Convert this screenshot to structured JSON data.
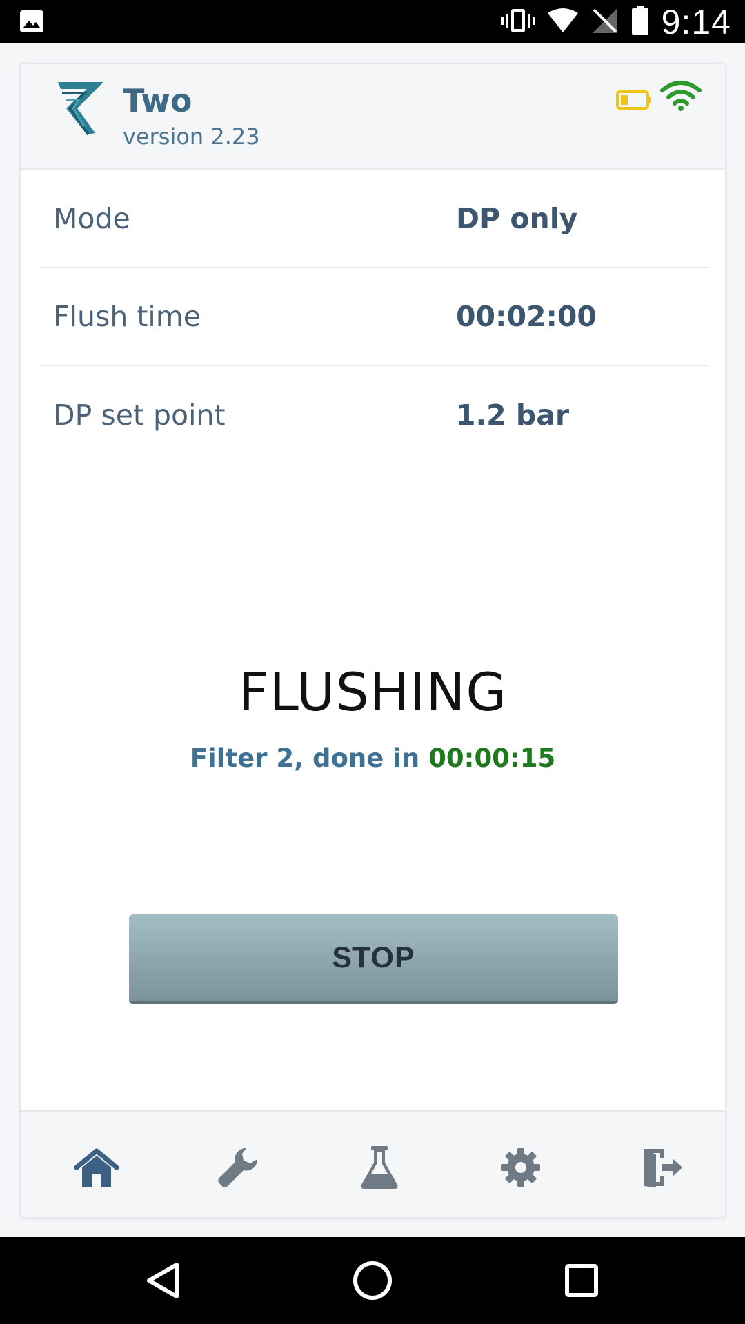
{
  "status_bar": {
    "time": "9:14",
    "icons": [
      "image-icon",
      "vibrate-icon",
      "wifi-signal-icon",
      "no-signal-icon",
      "battery-icon"
    ]
  },
  "header": {
    "app_name": "Two",
    "version": "version 2.23",
    "icons": [
      "logo-icon",
      "battery-low-icon",
      "wifi-icon"
    ],
    "colors": {
      "battery": "#f2c418",
      "wifi": "#2e9a2e"
    }
  },
  "settings": [
    {
      "label": "Mode",
      "value": "DP only"
    },
    {
      "label": "Flush time",
      "value": "00:02:00"
    },
    {
      "label": "DP set point",
      "value": "1.2 bar"
    }
  ],
  "status": {
    "title": "FLUSHING",
    "detail_prefix": "Filter 2, done in",
    "timer": "00:00:15",
    "colors": {
      "detail": "#3f7194",
      "timer": "#1f7a1f"
    }
  },
  "stop_button": {
    "label": "STOP"
  },
  "bottom_nav": {
    "items": [
      {
        "name": "home",
        "icon": "home-icon",
        "active": true
      },
      {
        "name": "tools",
        "icon": "wrench-icon",
        "active": false
      },
      {
        "name": "lab",
        "icon": "flask-icon",
        "active": false
      },
      {
        "name": "settings",
        "icon": "gear-icon",
        "active": false
      },
      {
        "name": "logout",
        "icon": "exit-icon",
        "active": false
      }
    ],
    "colors": {
      "active": "#3d5f82",
      "inactive": "#707a84"
    }
  },
  "android_nav": {
    "icons": [
      "back-icon",
      "home-circle-icon",
      "recents-icon"
    ]
  }
}
